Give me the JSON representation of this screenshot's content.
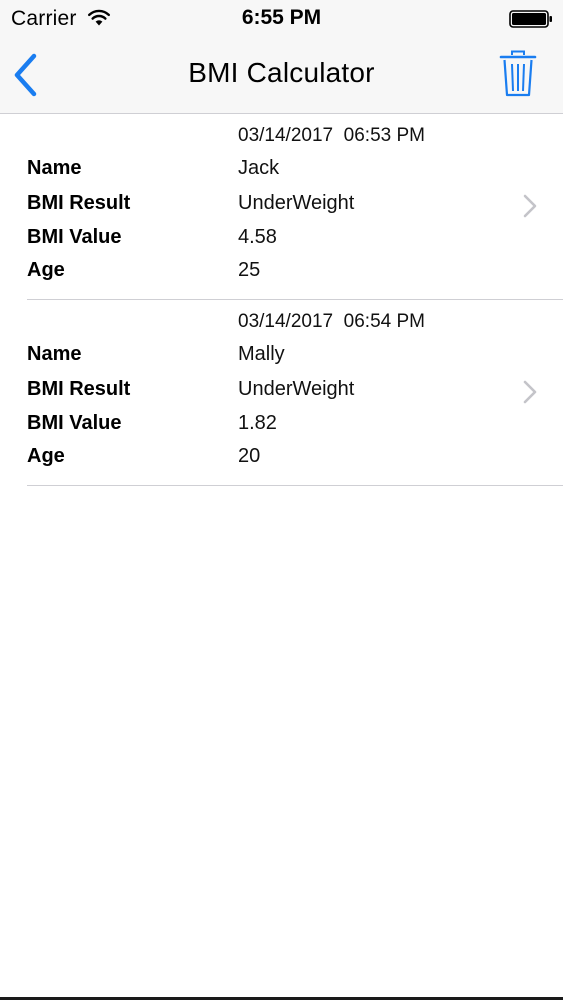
{
  "status_bar": {
    "carrier": "Carrier",
    "time": "6:55 PM",
    "icons": [
      "wifi-icon",
      "battery-icon"
    ]
  },
  "nav": {
    "title": "BMI Calculator",
    "back_icon": "chevron-left-icon",
    "delete_icon": "trash-icon",
    "tint_color": "#1a7df0"
  },
  "records": [
    {
      "timestamp": "03/14/2017  06:53 PM",
      "fields": [
        {
          "label": "Name",
          "value": "Jack"
        },
        {
          "label": "BMI Result",
          "value": "UnderWeight"
        },
        {
          "label": "BMI Value",
          "value": "4.58"
        },
        {
          "label": "Age",
          "value": "25"
        }
      ]
    },
    {
      "timestamp": "03/14/2017  06:54 PM",
      "fields": [
        {
          "label": "Name",
          "value": "Mally"
        },
        {
          "label": "BMI Result",
          "value": "UnderWeight"
        },
        {
          "label": "BMI Value",
          "value": "1.82"
        },
        {
          "label": "Age",
          "value": "20"
        }
      ]
    }
  ]
}
